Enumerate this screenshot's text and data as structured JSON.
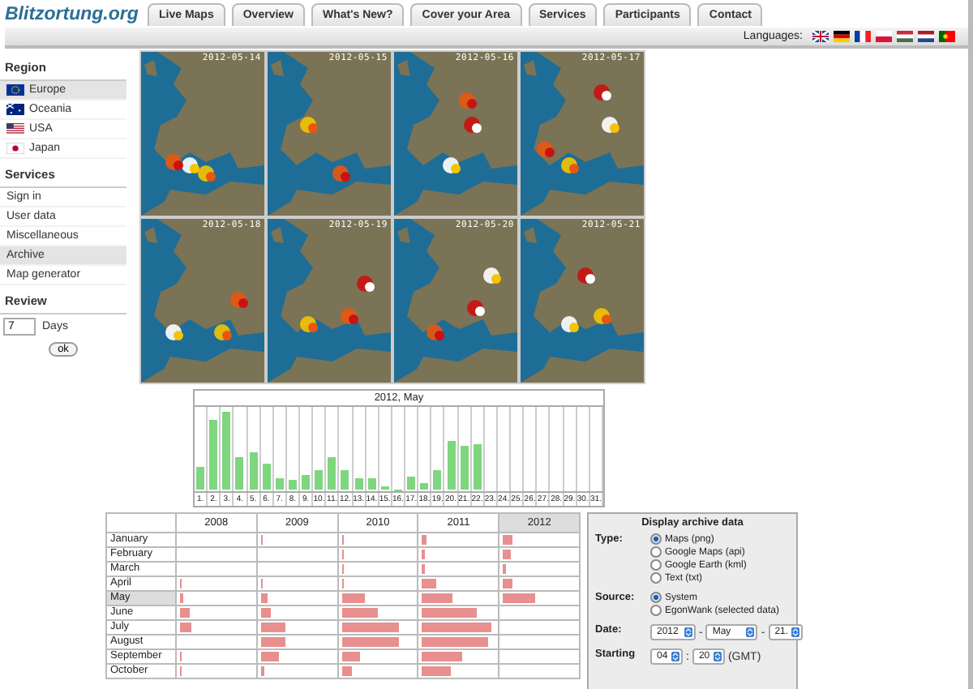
{
  "site": {
    "logo": "Blitzortung.org"
  },
  "nav_tabs": [
    {
      "label": "Live Maps"
    },
    {
      "label": "Overview"
    },
    {
      "label": "What's New?"
    },
    {
      "label": "Cover your Area"
    },
    {
      "label": "Services"
    },
    {
      "label": "Participants"
    },
    {
      "label": "Contact"
    }
  ],
  "languages": {
    "label": "Languages:",
    "flags": [
      {
        "kind": "gb"
      },
      {
        "kind": "de"
      },
      {
        "kind": "fr"
      },
      {
        "kind": "pl"
      },
      {
        "kind": "hu"
      },
      {
        "kind": "nl"
      },
      {
        "kind": "pt"
      }
    ]
  },
  "sidebar": {
    "region": {
      "heading": "Region",
      "items": [
        {
          "label": "Europe",
          "kind": "eu",
          "selected": true
        },
        {
          "label": "Oceania",
          "kind": "au",
          "selected": false
        },
        {
          "label": "USA",
          "kind": "us",
          "selected": false
        },
        {
          "label": "Japan",
          "kind": "jp",
          "selected": false
        }
      ]
    },
    "services": {
      "heading": "Services",
      "items": [
        {
          "label": "Sign in",
          "selected": false
        },
        {
          "label": "User data",
          "selected": false
        },
        {
          "label": "Miscellaneous",
          "selected": false
        },
        {
          "label": "Archive",
          "selected": true
        },
        {
          "label": "Map generator",
          "selected": false
        }
      ]
    },
    "review": {
      "heading": "Review",
      "value": "7",
      "unit": "Days",
      "button": "ok"
    }
  },
  "maps": [
    {
      "date": "2012-05-14"
    },
    {
      "date": "2012-05-15"
    },
    {
      "date": "2012-05-16"
    },
    {
      "date": "2012-05-17"
    },
    {
      "date": "2012-05-18"
    },
    {
      "date": "2012-05-19"
    },
    {
      "date": "2012-05-20"
    },
    {
      "date": "2012-05-21"
    }
  ],
  "daily_chart": {
    "title": "2012, May",
    "days": [
      {
        "label": "1.",
        "level": 0.3
      },
      {
        "label": "2.",
        "level": 0.9
      },
      {
        "label": "3.",
        "level": 1.0
      },
      {
        "label": "4.",
        "level": 0.42
      },
      {
        "label": "5.",
        "level": 0.47
      },
      {
        "label": "6.",
        "level": 0.33
      },
      {
        "label": "7.",
        "level": 0.14
      },
      {
        "label": "8.",
        "level": 0.12
      },
      {
        "label": "9.",
        "level": 0.19
      },
      {
        "label": "10.",
        "level": 0.24
      },
      {
        "label": "11.",
        "level": 0.42
      },
      {
        "label": "12.",
        "level": 0.24
      },
      {
        "label": "13.",
        "level": 0.14
      },
      {
        "label": "14.",
        "level": 0.15
      },
      {
        "label": "15.",
        "level": 0.05
      },
      {
        "label": "16.",
        "level": 0.01
      },
      {
        "label": "17.",
        "level": 0.16
      },
      {
        "label": "18.",
        "level": 0.08
      },
      {
        "label": "19.",
        "level": 0.24
      },
      {
        "label": "20.",
        "level": 0.62
      },
      {
        "label": "21.",
        "level": 0.57
      },
      {
        "label": "22.",
        "level": 0.58
      },
      {
        "label": "23."
      },
      {
        "label": "24."
      },
      {
        "label": "25."
      },
      {
        "label": "26."
      },
      {
        "label": "27."
      },
      {
        "label": "28."
      },
      {
        "label": "29."
      },
      {
        "label": "30."
      },
      {
        "label": "31."
      }
    ]
  },
  "archive_table": {
    "columns": [
      {
        "label": "2008",
        "selected": false
      },
      {
        "label": "2009",
        "selected": false
      },
      {
        "label": "2010",
        "selected": false
      },
      {
        "label": "2011",
        "selected": false
      },
      {
        "label": "2012",
        "selected": true
      }
    ],
    "rows": [
      {
        "month": "January",
        "selected": false,
        "cells": [
          null,
          {
            "level": 0.01
          },
          {
            "level": 0.03
          },
          {
            "level": 0.06
          },
          {
            "level": 0.12
          }
        ]
      },
      {
        "month": "February",
        "selected": false,
        "cells": [
          null,
          null,
          {
            "level": 0.02
          },
          {
            "level": 0.02
          },
          {
            "level": 0.1
          }
        ]
      },
      {
        "month": "March",
        "selected": false,
        "cells": [
          null,
          null,
          {
            "level": 0.02
          },
          {
            "level": 0.03
          },
          {
            "level": 0.04
          }
        ]
      },
      {
        "month": "April",
        "selected": false,
        "cells": [
          {
            "level": 0.01
          },
          {
            "level": 0.01
          },
          {
            "level": 0.02
          },
          {
            "level": 0.2
          },
          {
            "level": 0.13
          }
        ]
      },
      {
        "month": "May",
        "selected": true,
        "cells": [
          {
            "level": 0.05
          },
          {
            "level": 0.1
          },
          {
            "level": 0.33
          },
          {
            "level": 0.42
          },
          {
            "level": 0.45
          }
        ]
      },
      {
        "month": "June",
        "selected": false,
        "cells": [
          {
            "level": 0.13
          },
          {
            "level": 0.13
          },
          {
            "level": 0.5
          },
          {
            "level": 0.75
          },
          null
        ]
      },
      {
        "month": "July",
        "selected": false,
        "cells": [
          {
            "level": 0.15
          },
          {
            "level": 0.35
          },
          {
            "level": 0.78
          },
          {
            "level": 0.95
          },
          null
        ]
      },
      {
        "month": "August",
        "selected": false,
        "cells": [
          null,
          {
            "level": 0.33
          },
          {
            "level": 0.78
          },
          {
            "level": 0.9
          },
          null
        ]
      },
      {
        "month": "September",
        "selected": false,
        "cells": [
          {
            "level": 0.01
          },
          {
            "level": 0.24
          },
          {
            "level": 0.25
          },
          {
            "level": 0.55
          },
          null
        ]
      },
      {
        "month": "October",
        "selected": false,
        "cells": [
          {
            "level": 0.01
          },
          {
            "level": 0.05
          },
          {
            "level": 0.15
          },
          {
            "level": 0.4
          },
          null
        ]
      }
    ]
  },
  "archive_panel": {
    "title": "Display archive data",
    "type": {
      "label": "Type:",
      "options": [
        {
          "label": "Maps (png)",
          "selected": true
        },
        {
          "label": "Google Maps (api)",
          "selected": false
        },
        {
          "label": "Google Earth (kml)",
          "selected": false
        },
        {
          "label": "Text (txt)",
          "selected": false
        }
      ]
    },
    "source": {
      "label": "Source:",
      "options": [
        {
          "label": "System",
          "selected": true
        },
        {
          "label": "EgonWank (selected data)",
          "selected": false
        }
      ]
    },
    "date": {
      "label": "Date:",
      "year": "2012",
      "month": "May",
      "day": "21.",
      "separators": [
        "-",
        "-"
      ]
    },
    "starting": {
      "label": "Starting",
      "hour": "04",
      "minute": "20",
      "separator": ":",
      "zone": "(GMT)"
    }
  }
}
